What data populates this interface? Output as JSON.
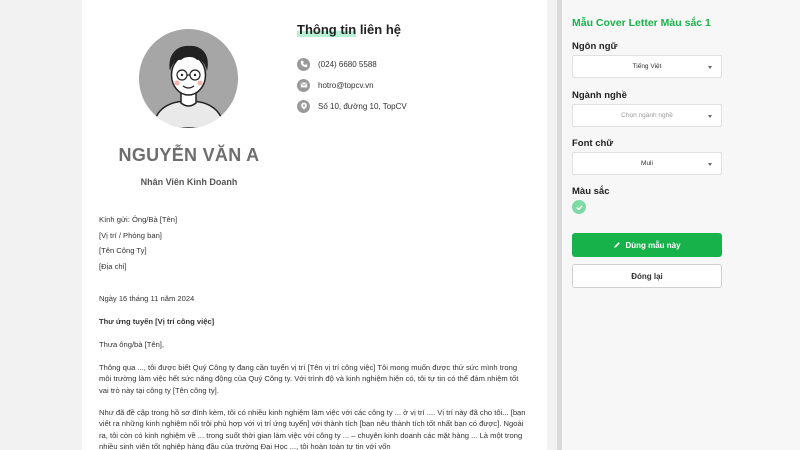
{
  "profile": {
    "name": "NGUYỄN VĂN A",
    "job_title": "Nhân Viên Kinh Doanh"
  },
  "contact": {
    "heading_highlight": "Thông tin",
    "heading_rest": " liên hệ",
    "phone": "(024) 6680 5588",
    "email": "hotro@topcv.vn",
    "address": "Số 10, đường 10, TopCV"
  },
  "letter": {
    "greeting_lines": [
      "Kính gửi: Ông/Bà [Tên]",
      "[Vị trí / Phòng ban]",
      "[Tên Công Ty]",
      "[Địa chỉ]"
    ],
    "date": "Ngày 16 tháng 11 năm 2024",
    "subject": "Thư ứng tuyển [Vị trí công việc]",
    "salutation": "Thưa ông/bà [Tên],",
    "para1": "Thông qua ..., tôi được biết Quý Công ty đang cần tuyển vị trí [Tên vị trí công việc] Tôi mong muốn được thử sức mình trong môi trường làm việc hết sức năng động của Quý Công ty. Với trình độ và kinh nghiệm hiện có, tôi tự tin có thể đảm nhiệm tốt vai trò này tại công ty [Tên công ty].",
    "para2": "Như đã đề cập trong hồ sơ đính kèm, tôi có nhiều kinh nghiệm làm việc với các công ty ... ở vị trí .... Vị trí này đã cho tôi... [bạn viết ra những kinh nghiệm nổi trội phù hợp với vị trí ứng tuyển] với thành tích [bạn nêu thành tích tốt nhất bạn có được]. Ngoài ra, tôi còn có kinh nghiệm về ... trong suốt thời gian làm việc với công ty ... – chuyên kinh doanh các mặt hàng ... Là một trong nhiều sinh viên tốt nghiệp hàng đầu của trường Đại Học ..., tôi hoàn toàn tự tin với vốn"
  },
  "panel": {
    "title": "Mẫu Cover Letter Màu sắc 1",
    "language_label": "Ngôn ngữ",
    "language_value": "Tiếng Việt",
    "industry_label": "Ngành nghề",
    "industry_placeholder": "Chọn ngành nghề",
    "font_label": "Font chữ",
    "font_value": "Muli",
    "color_label": "Màu sắc",
    "use_button": "Dùng mẫu này",
    "close_button": "Đóng lại"
  },
  "colors": {
    "accent": "#18b24b",
    "title_green": "#19b34a",
    "swatch": "#7fd9a4"
  }
}
